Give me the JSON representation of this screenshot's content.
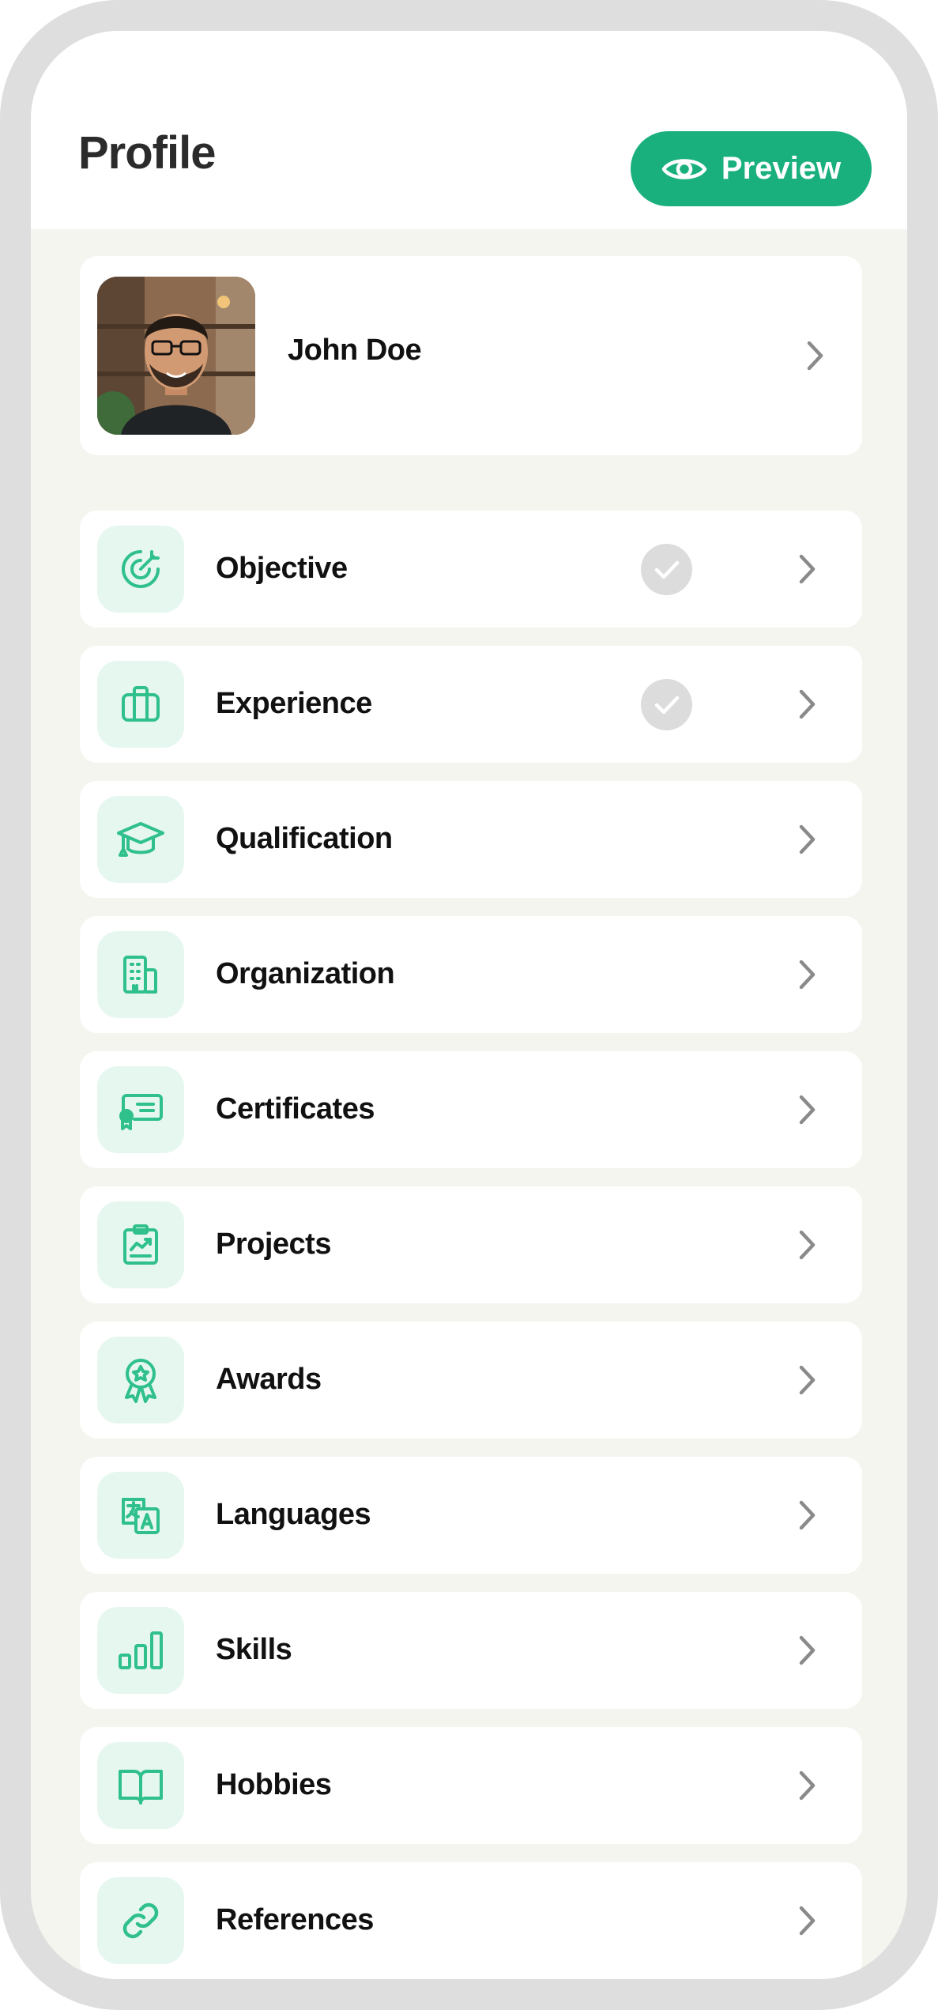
{
  "header": {
    "title": "Profile",
    "preview_label": "Preview",
    "preview_icon": "eye-icon"
  },
  "profile": {
    "name": "John Doe",
    "avatar": "avatar-photo"
  },
  "sections": [
    {
      "label": "Objective",
      "icon": "target-icon",
      "completed": true
    },
    {
      "label": "Experience",
      "icon": "briefcase-icon",
      "completed": true
    },
    {
      "label": "Qualification",
      "icon": "graduation-cap-icon",
      "completed": false
    },
    {
      "label": "Organization",
      "icon": "building-icon",
      "completed": false
    },
    {
      "label": "Certificates",
      "icon": "certificate-icon",
      "completed": false
    },
    {
      "label": "Projects",
      "icon": "clipboard-chart-icon",
      "completed": false
    },
    {
      "label": "Awards",
      "icon": "award-badge-icon",
      "completed": false
    },
    {
      "label": "Languages",
      "icon": "translate-icon",
      "completed": false
    },
    {
      "label": "Skills",
      "icon": "bar-chart-icon",
      "completed": false
    },
    {
      "label": "Hobbies",
      "icon": "open-book-icon",
      "completed": false
    },
    {
      "label": "References",
      "icon": "link-icon",
      "completed": false
    }
  ],
  "colors": {
    "accent": "#1ab07d",
    "icon_stroke": "#2fc08c",
    "icon_bg": "#e6f7f0",
    "background": "#f5f5ef",
    "check_bg": "#dcdcdc",
    "chevron": "#8a8a8a"
  }
}
